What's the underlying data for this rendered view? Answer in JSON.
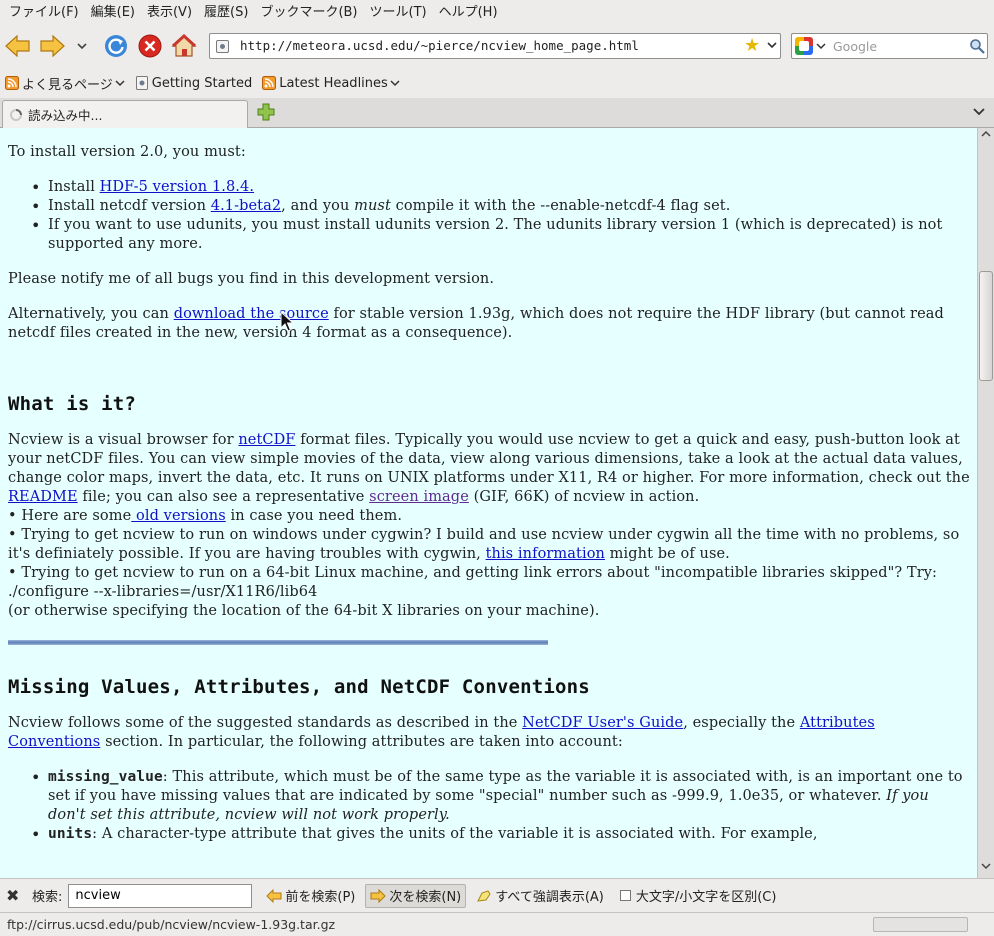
{
  "menu": [
    {
      "label": "ファイル(F)"
    },
    {
      "label": "編集(E)"
    },
    {
      "label": "表示(V)"
    },
    {
      "label": "履歴(S)"
    },
    {
      "label": "ブックマーク(B)"
    },
    {
      "label": "ツール(T)"
    },
    {
      "label": "ヘルプ(H)"
    }
  ],
  "toolbar": {
    "url": "http://meteora.ucsd.edu/~pierce/ncview_home_page.html",
    "search_placeholder": "Google"
  },
  "bookmarks": [
    {
      "label": "よく見るページ"
    },
    {
      "label": "Getting Started"
    },
    {
      "label": "Latest Headlines"
    }
  ],
  "tab": {
    "label": "読み込み中..."
  },
  "content": {
    "install_intro": "To install version 2.0, you must:",
    "install_items": {
      "hdf_pre": "Install ",
      "hdf_link": "HDF-5 version 1.8.4.",
      "netcdf_pre": "Install netcdf version ",
      "netcdf_link": "4.1-beta2",
      "netcdf_mid": ", and you ",
      "netcdf_must": "must",
      "netcdf_post": " compile it with the --enable-netcdf-4 flag set.",
      "udunits": "If you want to use udunits, you must install udunits version 2. The udunits library version 1 (which is deprecated) is not supported any more."
    },
    "notify": "Please notify me of all bugs you find in this development version.",
    "alt_pre": "Alternatively, you can ",
    "alt_link": "download the source",
    "alt_post": " for stable version 1.93g, which does not require the HDF library (but cannot read netcdf files created in the new, version 4 format as a consequence).",
    "what_heading": "What is it?",
    "what": {
      "p1": "Ncview is a visual browser for ",
      "netcdf_link": "netCDF",
      "p2": " format files. Typically you would use ncview to get a quick and easy, push-button look at your netCDF files. You can view simple movies of the data, view along various dimensions, take a look at the actual data values, change color maps, invert the data, etc. It runs on UNIX platforms under X11, R4 or higher. For more information, check out the ",
      "readme_link": "README",
      "p3": " file; you can also see a representative ",
      "screen_link": "screen image",
      "p4": " (GIF, 66K) of ncview in action.",
      "old_pre": "Here are some",
      "old_link": " old versions",
      "old_post": " in case you need them.",
      "cyg_pre": "Trying to get ncview to run on windows under cygwin? I build and use ncview under cygwin all the time with no problems, so it's definiately possible. If you are having troubles with cygwin, ",
      "cyg_link": "this information",
      "cyg_post": " might be of use.",
      "linux": "Trying to get ncview to run on a 64-bit Linux machine, and getting link errors about \"incompatible libraries skipped\"? Try:",
      "configure": "./configure --x-libraries=/usr/X11R6/lib64",
      "configure_note": "(or otherwise specifying the location of the 64-bit X libraries on your machine)."
    },
    "missing_heading": "Missing Values, Attributes, and NetCDF Conventions",
    "missing": {
      "p1": "Ncview follows some of the suggested standards as described in the ",
      "guide_link": "NetCDF User's Guide",
      "p2": ", especially the ",
      "attr_link": "Attributes Conventions",
      "p3": " section. In particular, the following attributes are taken into account:",
      "mv_term": "missing_value",
      "mv_text": ": This attribute, which must be of the same type as the variable it is associated with, is an important one to set if you have missing values that are indicated by some \"special\" number such as -999.9, 1.0e35, or whatever. ",
      "mv_warn": "If you don't set this attribute, ncview will not work properly.",
      "units_term": "units",
      "units_text": ": A character-type attribute that gives the units of the variable it is associated with. For example,"
    }
  },
  "findbar": {
    "label": "検索:",
    "value": "ncview",
    "prev": "前を検索(P)",
    "next": "次を検索(N)",
    "highlight": "すべて強調表示(A)",
    "case": "大文字/小文字を区別(C)"
  },
  "status": {
    "text": "ftp://cirrus.ucsd.edu/pub/ncview/ncview-1.93g.tar.gz"
  }
}
